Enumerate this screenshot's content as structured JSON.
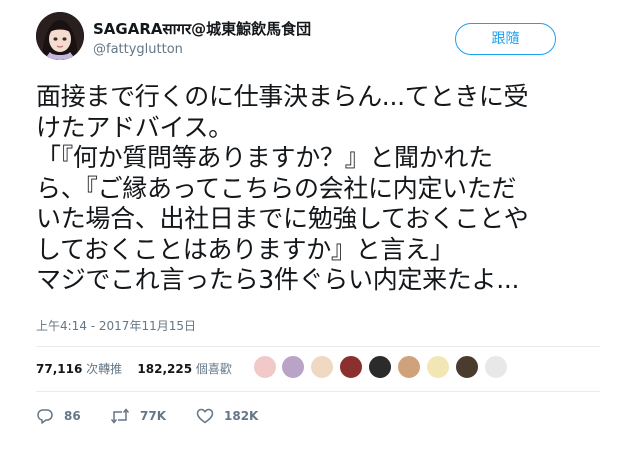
{
  "user": {
    "display_name": "SAGARAसागर@城東鯨飲馬食団",
    "handle": "@fattyglutton"
  },
  "follow_label": "跟隨",
  "tweet_lines": [
    "面接まで行くのに仕事決まらん...てときに受",
    "けたアドバイス。",
    "「『何か質問等ありますか？』と聞かれた",
    "ら、『ご縁あってこちらの会社に内定いただ",
    "いた場合、出社日までに勉強しておくことや",
    "しておくことはありますか』と言え」",
    "マジでこれ言ったら3件ぐらい内定来たよ..."
  ],
  "timestamp": "上午4:14 - 2017年11月15日",
  "stats": {
    "retweets_count": "77,116",
    "retweets_label": "次轉推",
    "likes_count": "182,225",
    "likes_label": "個喜歡"
  },
  "liker_avatars": [
    {
      "color": "#f2c9c9"
    },
    {
      "color": "#b9a3c7"
    },
    {
      "color": "#efd9c3"
    },
    {
      "color": "#8c2f2f"
    },
    {
      "color": "#2b2b2b"
    },
    {
      "color": "#cfa27c"
    },
    {
      "color": "#f3e6b5"
    },
    {
      "color": "#4a3b2f"
    },
    {
      "color": "#e8e8e8"
    }
  ],
  "actions": {
    "reply_count": "86",
    "retweet_count": "77K",
    "like_count": "182K"
  },
  "icons": {
    "reply": "reply-icon",
    "retweet": "retweet-icon",
    "like": "heart-icon"
  },
  "colors": {
    "accent": "#1da1f2",
    "muted": "#657786",
    "text": "#14171a"
  }
}
